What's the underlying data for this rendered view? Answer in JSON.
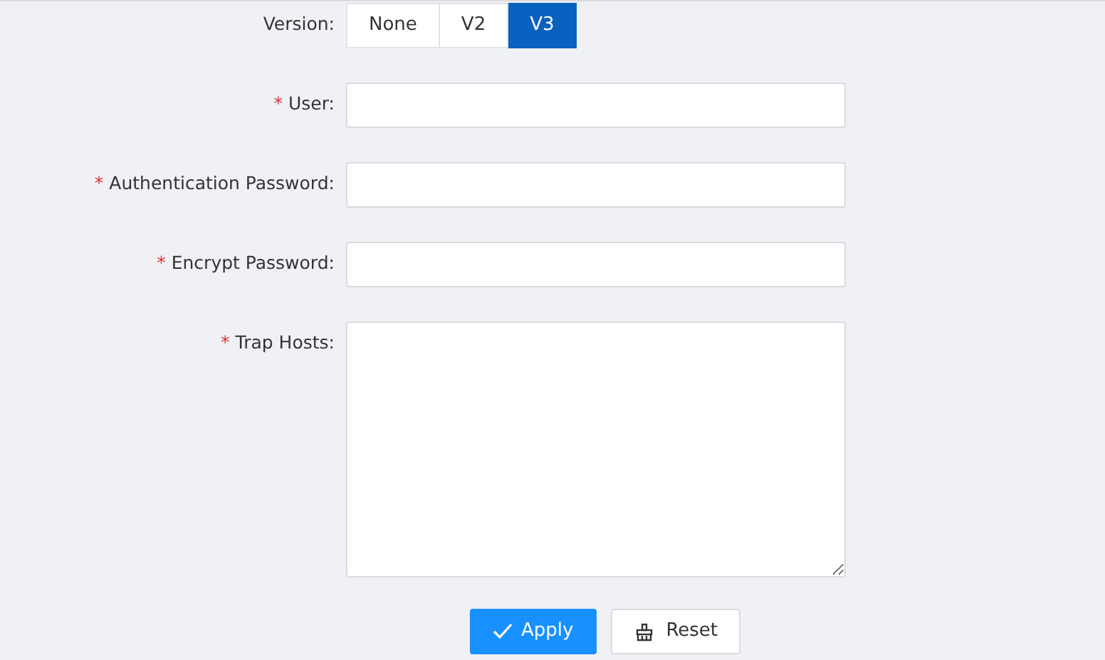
{
  "version": {
    "label": "Version:",
    "options": [
      {
        "label": "None",
        "selected": false
      },
      {
        "label": "V2",
        "selected": false
      },
      {
        "label": "V3",
        "selected": true
      }
    ]
  },
  "fields": [
    {
      "label": "User:",
      "required_mark": "*",
      "kind": "input"
    },
    {
      "label": "Authentication Password:",
      "required_mark": "*",
      "kind": "input"
    },
    {
      "label": "Encrypt Password:",
      "required_mark": "*",
      "kind": "input"
    },
    {
      "label": "Trap Hosts:",
      "required_mark": "*",
      "kind": "textarea"
    }
  ],
  "buttons": [
    {
      "label": "Apply",
      "kind": "primary"
    },
    {
      "label": "Reset",
      "kind": "reset"
    }
  ]
}
